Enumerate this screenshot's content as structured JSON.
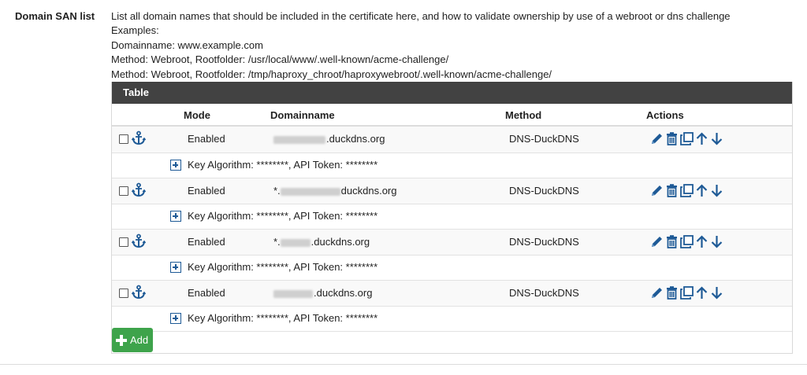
{
  "field": {
    "label": "Domain SAN list"
  },
  "help": {
    "line1": "List all domain names that should be included in the certificate here, and how to validate ownership by use of a webroot or dns challenge",
    "line2": "Examples:",
    "line3": "Domainname: www.example.com",
    "line4": "Method: Webroot, Rootfolder: /usr/local/www/.well-known/acme-challenge/",
    "line5": "Method: Webroot, Rootfolder: /tmp/haproxy_chroot/haproxywebroot/.well-known/acme-challenge/"
  },
  "table": {
    "heading": "Table",
    "columns": {
      "mode": "Mode",
      "domainname": "Domainname",
      "method": "Method",
      "actions": "Actions"
    },
    "rows": [
      {
        "mode": "Enabled",
        "prefix": "",
        "domain_suffix": ".duckdns.org",
        "method": "DNS-DuckDNS",
        "details": "Key Algorithm: ********, API Token: ********"
      },
      {
        "mode": "Enabled",
        "prefix": "*.",
        "domain_suffix": "duckdns.org",
        "method": "DNS-DuckDNS",
        "details": "Key Algorithm: ********, API Token: ********"
      },
      {
        "mode": "Enabled",
        "prefix": "*.",
        "domain_suffix": ".duckdns.org",
        "method": "DNS-DuckDNS",
        "details": "Key Algorithm: ********, API Token: ********"
      },
      {
        "mode": "Enabled",
        "prefix": "",
        "domain_suffix": ".duckdns.org",
        "method": "DNS-DuckDNS",
        "details": "Key Algorithm: ********, API Token: ********"
      }
    ],
    "icons": [
      "anchor-icon",
      "pencil-icon",
      "trash-icon",
      "copy-icon",
      "arrow-up-icon",
      "arrow-down-icon",
      "plus-square-icon"
    ],
    "add_label": "Add"
  },
  "colors": {
    "header_bg": "#424242",
    "icon_blue": "#1e5a96",
    "add_green": "#3ea34b"
  }
}
